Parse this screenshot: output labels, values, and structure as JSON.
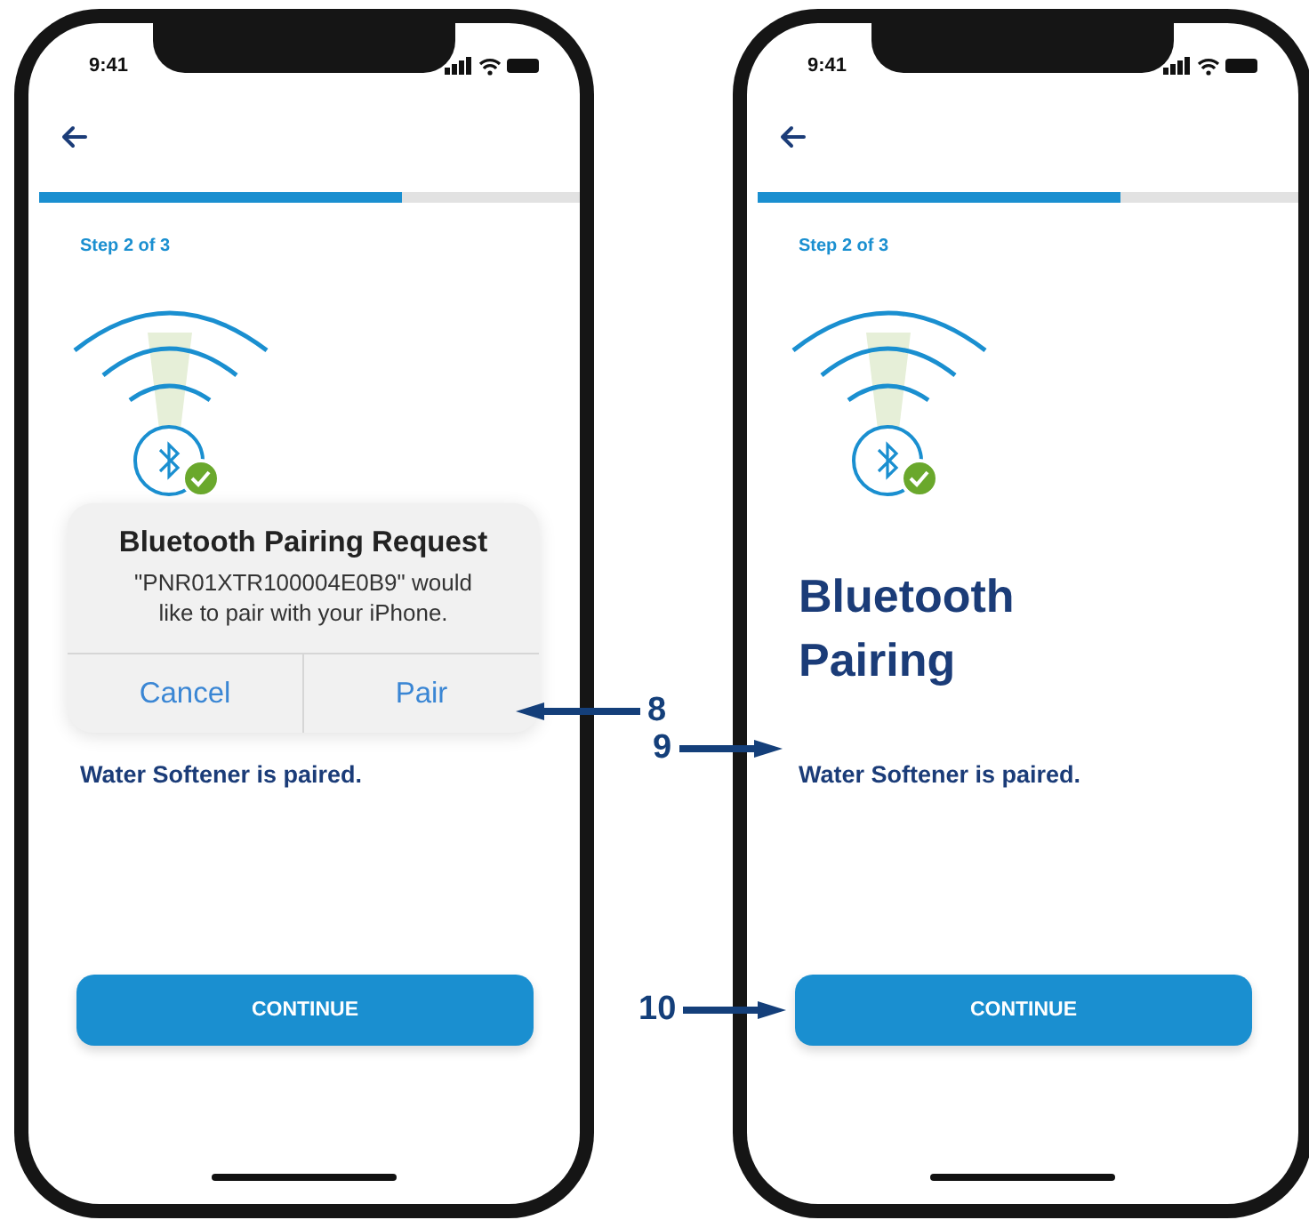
{
  "screens": [
    {
      "status_bar": {
        "time": "9:41"
      },
      "progress": {
        "level": 0.67
      },
      "step": "Step 2 of 3",
      "message": "Water Softener is paired.",
      "button": "CONTINUE",
      "alert": {
        "title": "Bluetooth Pairing Request",
        "message": "\"PNR01XTR100004E0B9\" would like to pair with your iPhone.",
        "buttons": [
          "Cancel",
          "Pair"
        ]
      }
    },
    {
      "status_bar": {
        "time": "9:41"
      },
      "progress": {
        "level": 0.67
      },
      "step": "Step 2 of 3",
      "title": "Bluetooth Pairing",
      "message": "Water Softener is paired.",
      "button": "CONTINUE"
    }
  ],
  "callouts": [
    {
      "number": "8",
      "kind": "left"
    },
    {
      "number": "9",
      "kind": "right"
    },
    {
      "number": "10",
      "kind": "right"
    }
  ]
}
